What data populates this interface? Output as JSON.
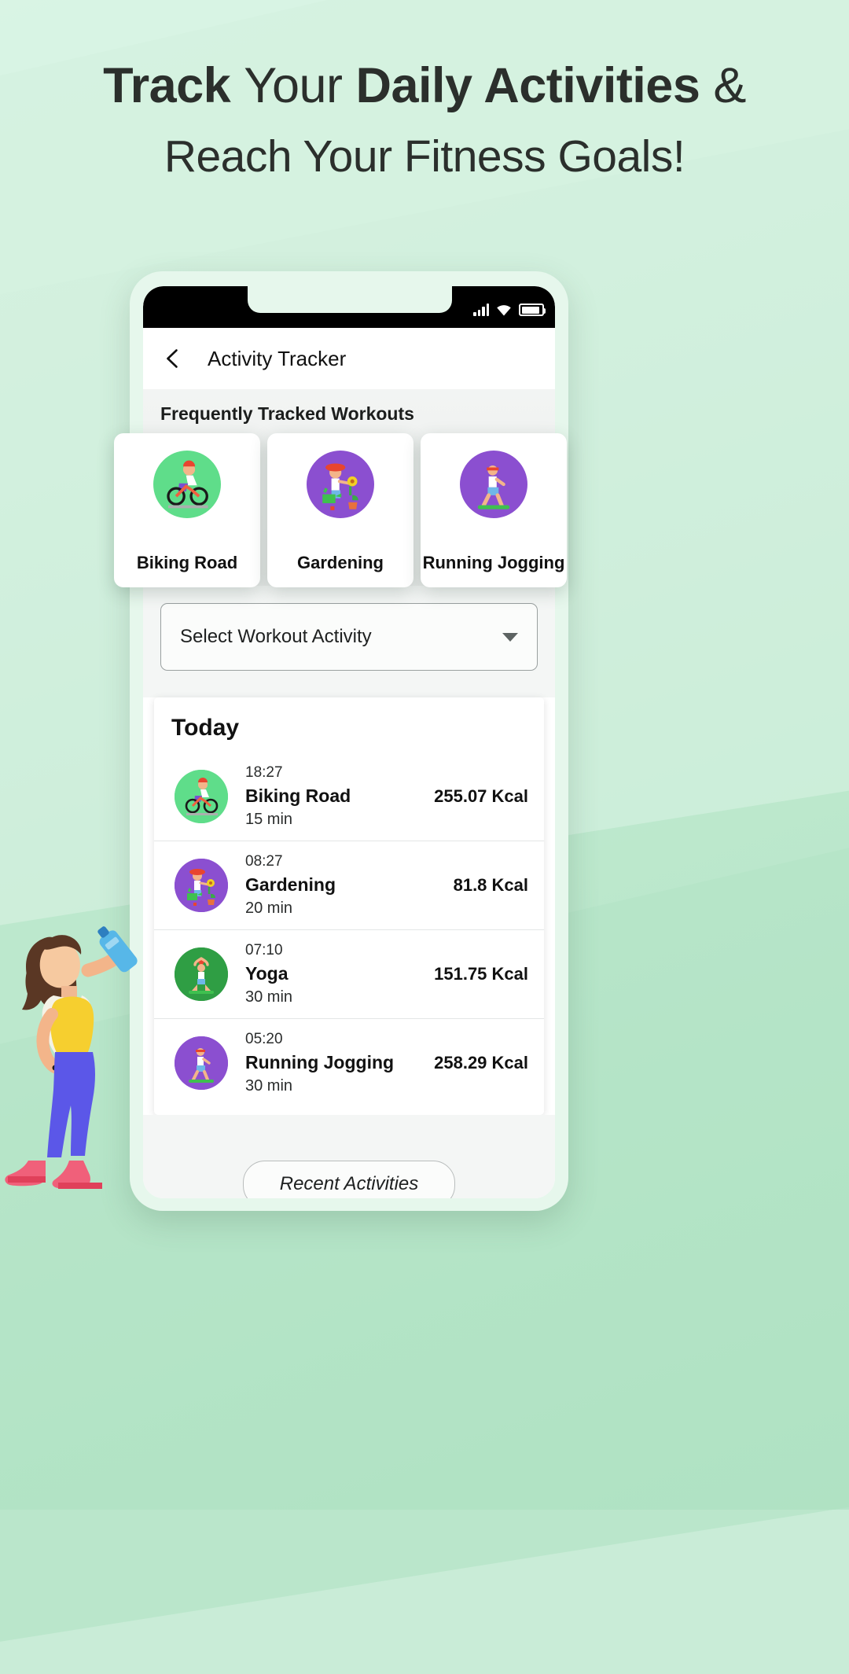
{
  "headline": {
    "line1_part1": "Track ",
    "line1_part2": "Your ",
    "line1_part3": "Daily Activities",
    "line1_part4": " &",
    "line2": "Reach Your Fitness Goals!"
  },
  "colors": {
    "background_light": "#d9f3e2",
    "background_dark": "#a8dfbd",
    "phone_body": "#e6f7ec",
    "text_dark": "#2b2f2c",
    "icon_green": "#5fdd8a",
    "icon_purple": "#8b4fd0",
    "icon_dark_green": "#2f9e44"
  },
  "statusbar": {
    "signal_icon": "signal-bars-icon",
    "wifi_icon": "wifi-icon",
    "battery_icon": "battery-icon"
  },
  "appbar": {
    "back_icon": "back-arrow-icon",
    "title": "Activity Tracker"
  },
  "section": {
    "title": "Frequently Tracked Workouts"
  },
  "workout_cards": [
    {
      "label": "Biking Road",
      "icon": "cyclist-icon",
      "bg": "#5fdd8a"
    },
    {
      "label": "Gardening",
      "icon": "gardener-icon",
      "bg": "#8b4fd0"
    },
    {
      "label": "Running Jogging",
      "icon": "runner-icon",
      "bg": "#8b4fd0"
    }
  ],
  "dropdown": {
    "value": "Select Workout Activity",
    "caret_icon": "chevron-down-icon"
  },
  "today": {
    "title": "Today",
    "activities": [
      {
        "time": "18:27",
        "name": "Biking Road",
        "duration": "15 min",
        "calories": "255.07 Kcal",
        "icon": "cyclist-icon",
        "bg": "#5fdd8a"
      },
      {
        "time": "08:27",
        "name": "Gardening",
        "duration": "20 min",
        "calories": "81.8 Kcal",
        "icon": "gardener-icon",
        "bg": "#8b4fd0"
      },
      {
        "time": "07:10",
        "name": "Yoga",
        "duration": "30 min",
        "calories": "151.75 Kcal",
        "icon": "yoga-icon",
        "bg": "#2f9e44"
      },
      {
        "time": "05:20",
        "name": "Running Jogging",
        "duration": "30 min",
        "calories": "258.29 Kcal",
        "icon": "runner-icon",
        "bg": "#8b4fd0"
      }
    ]
  },
  "recent_button": {
    "label": "Recent Activities"
  },
  "navbar": {
    "back_icon": "nav-back-triangle-icon",
    "home_icon": "nav-home-circle-icon",
    "recents_icon": "nav-recents-square-icon"
  },
  "illustration": {
    "name": "woman-drinking-water-illustration"
  }
}
